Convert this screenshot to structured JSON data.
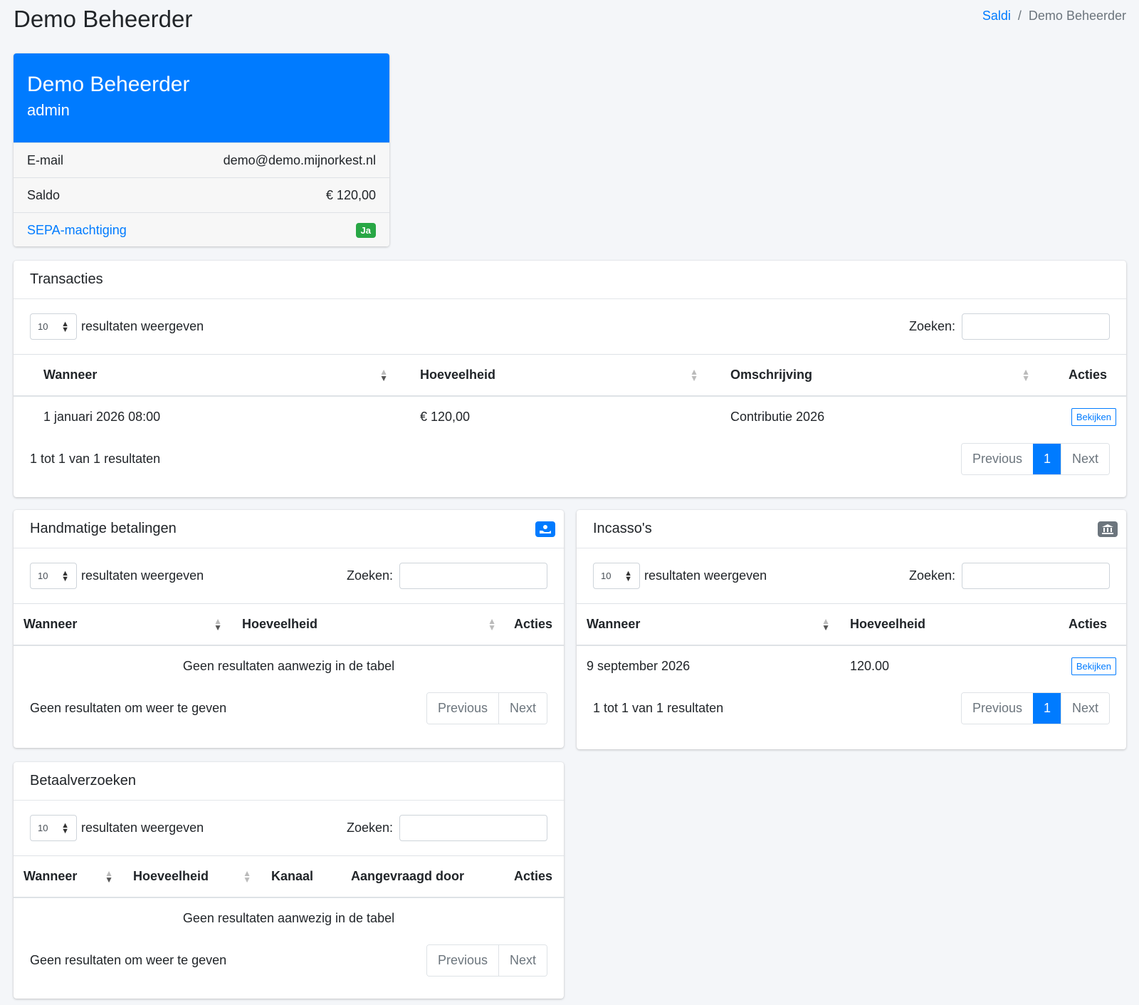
{
  "page": {
    "title": "Demo Beheerder"
  },
  "breadcrumb": {
    "link": "Saldi",
    "separator": "/",
    "current": "Demo Beheerder"
  },
  "profile": {
    "name": "Demo Beheerder",
    "role": "admin",
    "email_label": "E-mail",
    "email_value": "demo@demo.mijnorkest.nl",
    "saldo_label": "Saldo",
    "saldo_value": "€ 120,00",
    "sepa_label": "SEPA-machtiging",
    "sepa_value": "Ja"
  },
  "common": {
    "length_value": "10",
    "length_suffix": "resultaten weergeven",
    "search_label": "Zoeken:",
    "previous": "Previous",
    "next": "Next",
    "page": "1",
    "view_button": "Bekijken",
    "empty_table": "Geen resultaten aanwezig in de tabel",
    "empty_info": "Geen resultaten om weer te geven"
  },
  "transacties": {
    "title": "Transacties",
    "columns": [
      "Wanneer",
      "Hoeveelheid",
      "Omschrijving",
      "Acties"
    ],
    "rows": [
      {
        "wanneer": "1 januari 2026 08:00",
        "hoeveelheid": "€ 120,00",
        "omschrijving": "Contributie 2026"
      }
    ],
    "info": "1 tot 1 van 1 resultaten"
  },
  "handmatig": {
    "title": "Handmatige betalingen",
    "icon": "hand-money-icon",
    "columns": [
      "Wanneer",
      "Hoeveelheid",
      "Acties"
    ]
  },
  "incassos": {
    "title": "Incasso's",
    "icon": "bank-icon",
    "columns": [
      "Wanneer",
      "Hoeveelheid",
      "Acties"
    ],
    "rows": [
      {
        "wanneer": "9 september 2026",
        "hoeveelheid": "120.00"
      }
    ],
    "info": "1 tot 1 van 1 resultaten"
  },
  "betaalverzoeken": {
    "title": "Betaalverzoeken",
    "columns": [
      "Wanneer",
      "Hoeveelheid",
      "Kanaal",
      "Aangevraagd door",
      "Acties"
    ]
  },
  "colors": {
    "primary": "#007bff",
    "success": "#28a745",
    "secondary": "#6c757d"
  }
}
